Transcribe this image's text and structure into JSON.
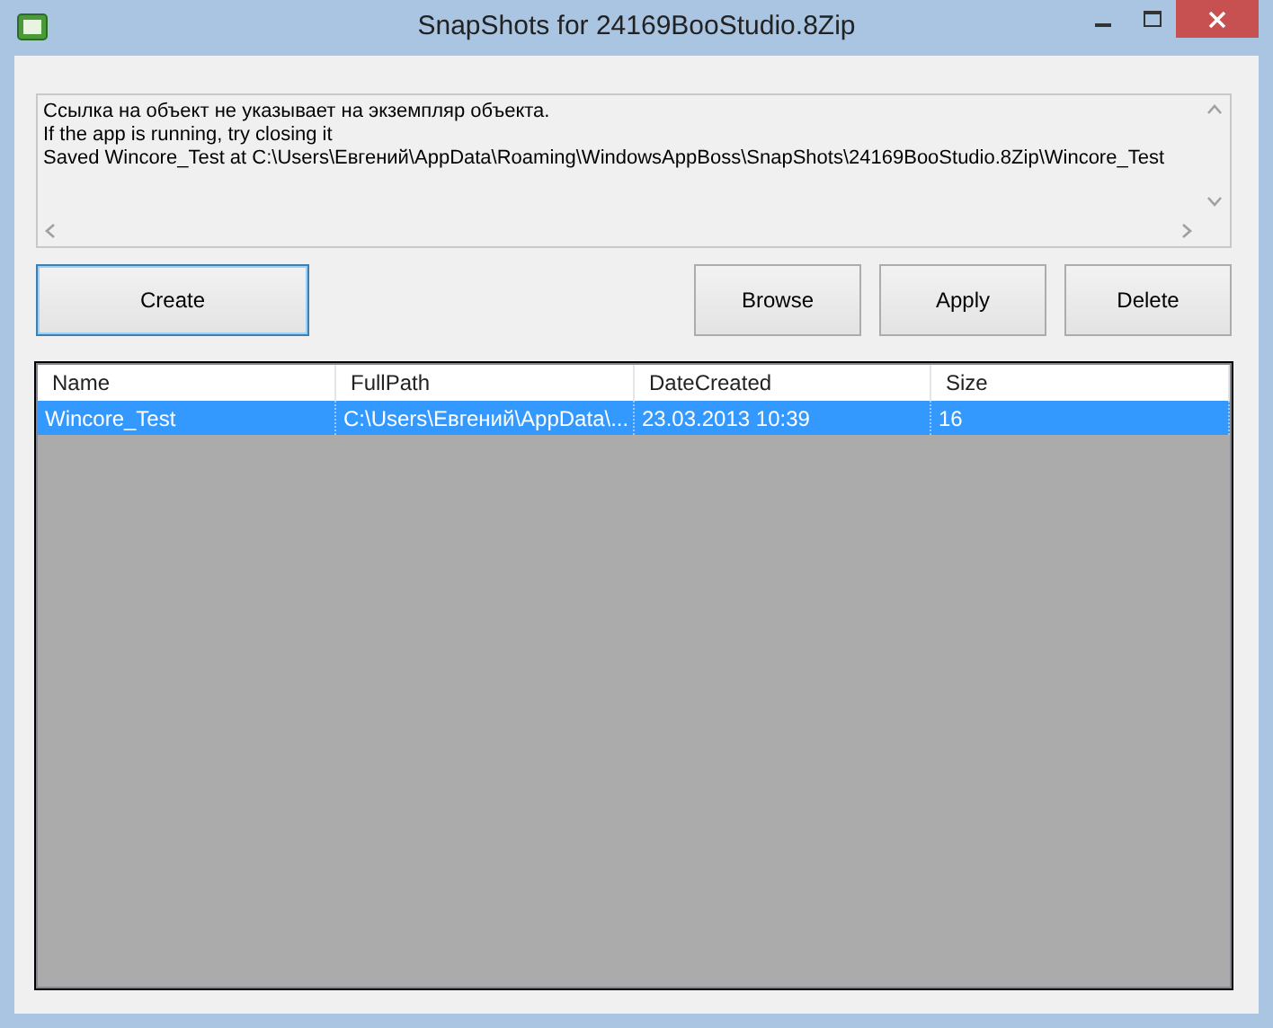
{
  "window": {
    "title": "SnapShots for 24169BooStudio.8Zip"
  },
  "log": {
    "lines": [
      "Ссылка на объект не указывает на экземпляр объекта.",
      "If the app is running, try closing it",
      "Saved Wincore_Test at C:\\Users\\Евгений\\AppData\\Roaming\\WindowsAppBoss\\SnapShots\\24169BooStudio.8Zip\\Wincore_Test"
    ]
  },
  "buttons": [
    {
      "label": "Create",
      "focused": true
    },
    {
      "label": "Browse",
      "focused": false
    },
    {
      "label": "Apply",
      "focused": false
    },
    {
      "label": "Delete",
      "focused": false
    }
  ],
  "table": {
    "columns": [
      "Name",
      "FullPath",
      "DateCreated",
      "Size"
    ],
    "rows": [
      {
        "cells": [
          "Wincore_Test",
          "C:\\Users\\Евгений\\AppData\\...",
          "23.03.2013 10:39",
          "16"
        ],
        "selected": true
      }
    ]
  }
}
